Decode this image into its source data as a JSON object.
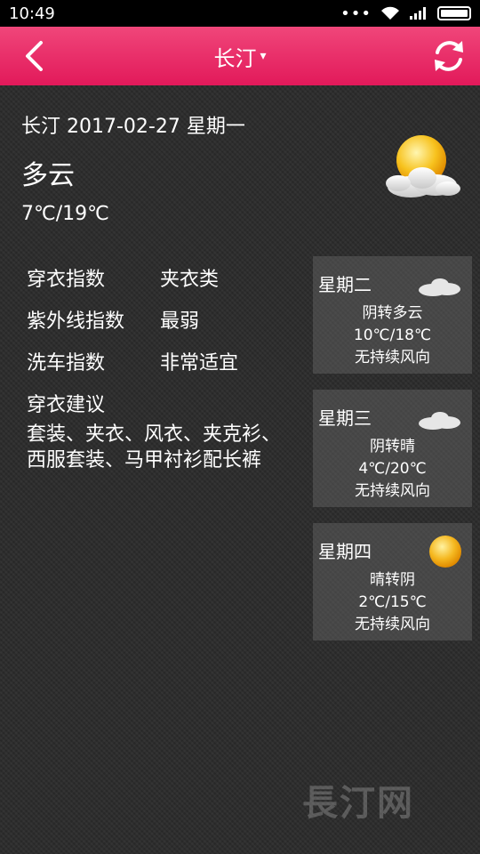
{
  "status_bar": {
    "time": "10:49",
    "dots": "•••"
  },
  "app_bar": {
    "title": "长汀",
    "caret": "▾"
  },
  "today": {
    "headline": "长汀 2017-02-27 星期一",
    "description": "多云",
    "temperature": "7℃/19℃",
    "icon": "sun-cloud-icon"
  },
  "indices": [
    {
      "label": "穿衣指数",
      "value": "夹衣类"
    },
    {
      "label": "紫外线指数",
      "value": "最弱"
    },
    {
      "label": "洗车指数",
      "value": "非常适宜"
    }
  ],
  "advice": {
    "label": "穿衣建议",
    "text": "套装、夹衣、风衣、夹克衫、西服套装、马甲衬衫配长裤"
  },
  "forecast": [
    {
      "day": "星期二",
      "weather": "阴转多云",
      "temp": "10℃/18℃",
      "wind": "无持续风向",
      "icon": "cloud-icon"
    },
    {
      "day": "星期三",
      "weather": "阴转晴",
      "temp": "4℃/20℃",
      "wind": "无持续风向",
      "icon": "cloud-icon"
    },
    {
      "day": "星期四",
      "weather": "晴转阴",
      "temp": "2℃/15℃",
      "wind": "无持续风向",
      "icon": "sun-icon"
    }
  ],
  "watermark": "長汀网",
  "colors": {
    "appbar": "#e2195a",
    "background": "#2b2b2b",
    "sun": "#f5b820"
  }
}
